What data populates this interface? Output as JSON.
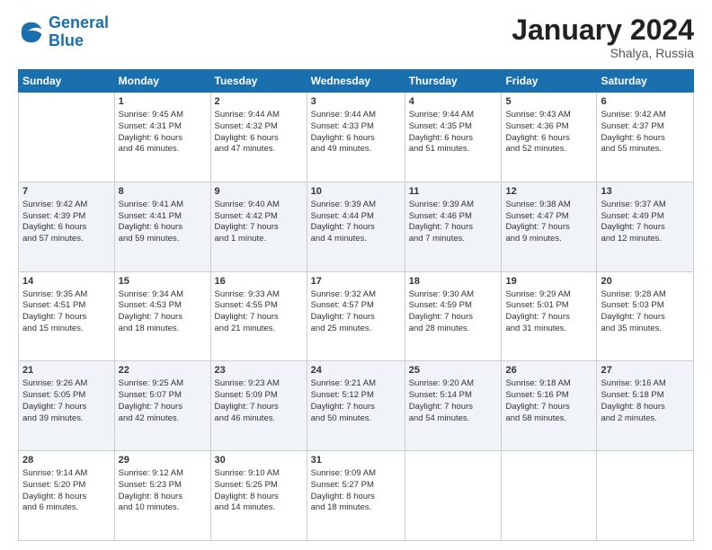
{
  "logo": {
    "text_general": "General",
    "text_blue": "Blue"
  },
  "title": "January 2024",
  "subtitle": "Shalya, Russia",
  "headers": [
    "Sunday",
    "Monday",
    "Tuesday",
    "Wednesday",
    "Thursday",
    "Friday",
    "Saturday"
  ],
  "weeks": [
    {
      "shaded": false,
      "days": [
        {
          "num": "",
          "info": ""
        },
        {
          "num": "1",
          "info": "Sunrise: 9:45 AM\nSunset: 4:31 PM\nDaylight: 6 hours\nand 46 minutes."
        },
        {
          "num": "2",
          "info": "Sunrise: 9:44 AM\nSunset: 4:32 PM\nDaylight: 6 hours\nand 47 minutes."
        },
        {
          "num": "3",
          "info": "Sunrise: 9:44 AM\nSunset: 4:33 PM\nDaylight: 6 hours\nand 49 minutes."
        },
        {
          "num": "4",
          "info": "Sunrise: 9:44 AM\nSunset: 4:35 PM\nDaylight: 6 hours\nand 51 minutes."
        },
        {
          "num": "5",
          "info": "Sunrise: 9:43 AM\nSunset: 4:36 PM\nDaylight: 6 hours\nand 52 minutes."
        },
        {
          "num": "6",
          "info": "Sunrise: 9:42 AM\nSunset: 4:37 PM\nDaylight: 6 hours\nand 55 minutes."
        }
      ]
    },
    {
      "shaded": true,
      "days": [
        {
          "num": "7",
          "info": "Sunrise: 9:42 AM\nSunset: 4:39 PM\nDaylight: 6 hours\nand 57 minutes."
        },
        {
          "num": "8",
          "info": "Sunrise: 9:41 AM\nSunset: 4:41 PM\nDaylight: 6 hours\nand 59 minutes."
        },
        {
          "num": "9",
          "info": "Sunrise: 9:40 AM\nSunset: 4:42 PM\nDaylight: 7 hours\nand 1 minute."
        },
        {
          "num": "10",
          "info": "Sunrise: 9:39 AM\nSunset: 4:44 PM\nDaylight: 7 hours\nand 4 minutes."
        },
        {
          "num": "11",
          "info": "Sunrise: 9:39 AM\nSunset: 4:46 PM\nDaylight: 7 hours\nand 7 minutes."
        },
        {
          "num": "12",
          "info": "Sunrise: 9:38 AM\nSunset: 4:47 PM\nDaylight: 7 hours\nand 9 minutes."
        },
        {
          "num": "13",
          "info": "Sunrise: 9:37 AM\nSunset: 4:49 PM\nDaylight: 7 hours\nand 12 minutes."
        }
      ]
    },
    {
      "shaded": false,
      "days": [
        {
          "num": "14",
          "info": "Sunrise: 9:35 AM\nSunset: 4:51 PM\nDaylight: 7 hours\nand 15 minutes."
        },
        {
          "num": "15",
          "info": "Sunrise: 9:34 AM\nSunset: 4:53 PM\nDaylight: 7 hours\nand 18 minutes."
        },
        {
          "num": "16",
          "info": "Sunrise: 9:33 AM\nSunset: 4:55 PM\nDaylight: 7 hours\nand 21 minutes."
        },
        {
          "num": "17",
          "info": "Sunrise: 9:32 AM\nSunset: 4:57 PM\nDaylight: 7 hours\nand 25 minutes."
        },
        {
          "num": "18",
          "info": "Sunrise: 9:30 AM\nSunset: 4:59 PM\nDaylight: 7 hours\nand 28 minutes."
        },
        {
          "num": "19",
          "info": "Sunrise: 9:29 AM\nSunset: 5:01 PM\nDaylight: 7 hours\nand 31 minutes."
        },
        {
          "num": "20",
          "info": "Sunrise: 9:28 AM\nSunset: 5:03 PM\nDaylight: 7 hours\nand 35 minutes."
        }
      ]
    },
    {
      "shaded": true,
      "days": [
        {
          "num": "21",
          "info": "Sunrise: 9:26 AM\nSunset: 5:05 PM\nDaylight: 7 hours\nand 39 minutes."
        },
        {
          "num": "22",
          "info": "Sunrise: 9:25 AM\nSunset: 5:07 PM\nDaylight: 7 hours\nand 42 minutes."
        },
        {
          "num": "23",
          "info": "Sunrise: 9:23 AM\nSunset: 5:09 PM\nDaylight: 7 hours\nand 46 minutes."
        },
        {
          "num": "24",
          "info": "Sunrise: 9:21 AM\nSunset: 5:12 PM\nDaylight: 7 hours\nand 50 minutes."
        },
        {
          "num": "25",
          "info": "Sunrise: 9:20 AM\nSunset: 5:14 PM\nDaylight: 7 hours\nand 54 minutes."
        },
        {
          "num": "26",
          "info": "Sunrise: 9:18 AM\nSunset: 5:16 PM\nDaylight: 7 hours\nand 58 minutes."
        },
        {
          "num": "27",
          "info": "Sunrise: 9:16 AM\nSunset: 5:18 PM\nDaylight: 8 hours\nand 2 minutes."
        }
      ]
    },
    {
      "shaded": false,
      "days": [
        {
          "num": "28",
          "info": "Sunrise: 9:14 AM\nSunset: 5:20 PM\nDaylight: 8 hours\nand 6 minutes."
        },
        {
          "num": "29",
          "info": "Sunrise: 9:12 AM\nSunset: 5:23 PM\nDaylight: 8 hours\nand 10 minutes."
        },
        {
          "num": "30",
          "info": "Sunrise: 9:10 AM\nSunset: 5:25 PM\nDaylight: 8 hours\nand 14 minutes."
        },
        {
          "num": "31",
          "info": "Sunrise: 9:09 AM\nSunset: 5:27 PM\nDaylight: 8 hours\nand 18 minutes."
        },
        {
          "num": "",
          "info": ""
        },
        {
          "num": "",
          "info": ""
        },
        {
          "num": "",
          "info": ""
        }
      ]
    }
  ]
}
